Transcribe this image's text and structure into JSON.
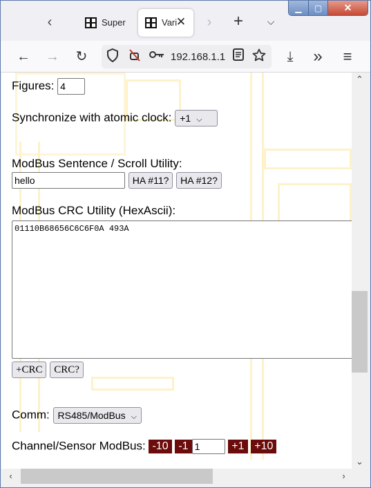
{
  "tabs": [
    {
      "title": "Super",
      "active": false
    },
    {
      "title": "Vari",
      "active": true
    }
  ],
  "tabstrip": {
    "new_tab": "+",
    "list_tabs": "⌵"
  },
  "window": {
    "minimize": "▁",
    "maximize": "▢",
    "close": "✕"
  },
  "nav": {
    "back": "←",
    "forward": "→",
    "reload": "↻",
    "url": "192.168.1.1",
    "download": "⤓",
    "overflow": "»",
    "menu": "≡"
  },
  "form": {
    "figures_label": "Figures:",
    "figures_value": "4",
    "sync_label": "Synchronize with atomic clock:",
    "sync_value": "+1",
    "modbus_label": "ModBus Sentence / Scroll Utility:",
    "modbus_value": "hello",
    "ha11_label": "HA #11?",
    "ha12_label": "HA #12?",
    "crc_label": "ModBus CRC Utility (HexAscii):",
    "crc_value": "01110B68656C6C6F0A 493A",
    "add_crc_label": "+CRC",
    "check_crc_label": "CRC?",
    "comm_label": "Comm:",
    "comm_value": "RS485/ModBus",
    "channel_label": "Channel/Sensor ModBus:",
    "minus10": "-10",
    "minus1": "-1",
    "channel_value": "1",
    "plus1": "+1",
    "plus10": "+10"
  },
  "colors": {
    "step_button_bg": "#6b0b0b",
    "watermark": "#fdf2c8",
    "window_frame": "#5b77ad"
  },
  "icons": {
    "tracking": "shield-icon",
    "permissions": "camera-off-icon",
    "key": "key-icon",
    "reader": "reader-view-icon",
    "bookmark": "star-icon"
  }
}
